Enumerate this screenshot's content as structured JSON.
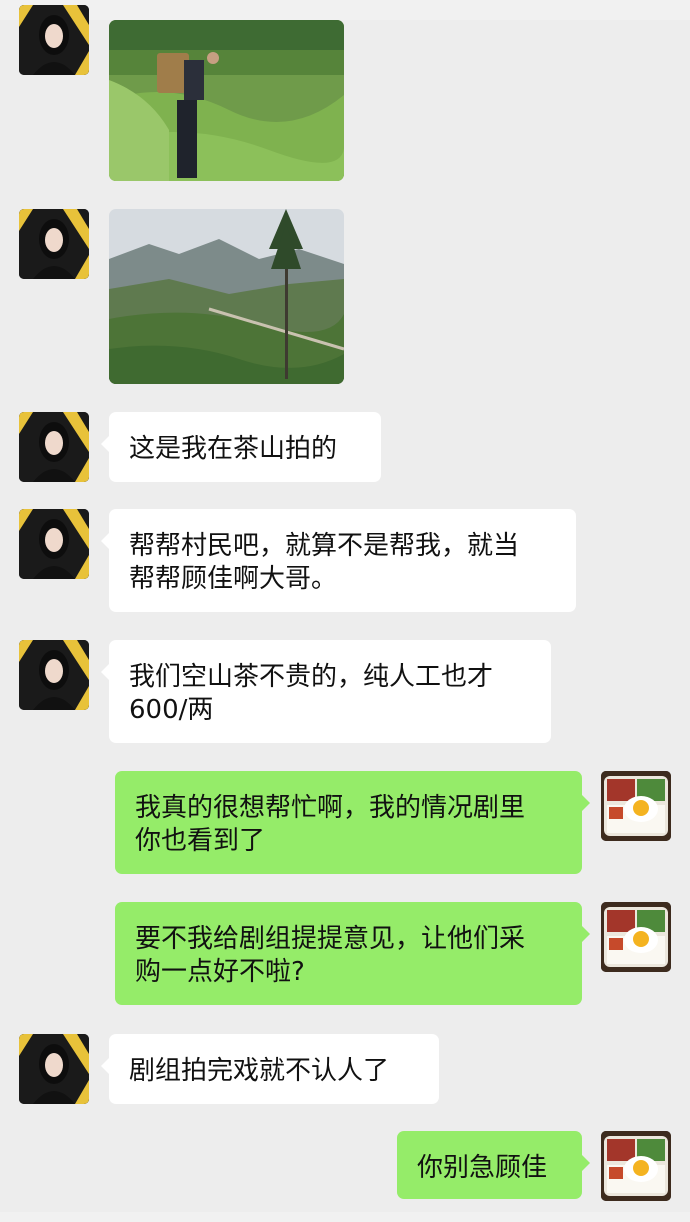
{
  "messages": [
    {
      "side": "left",
      "type": "image",
      "image": "tea-farmer-photo"
    },
    {
      "side": "left",
      "type": "image",
      "image": "tea-mountain-photo"
    },
    {
      "side": "left",
      "type": "text",
      "lines": [
        "这是我在茶山拍的"
      ]
    },
    {
      "side": "left",
      "type": "text",
      "lines": [
        "帮帮村民吧，就算不是帮我，就当",
        "帮帮顾佳啊大哥。"
      ]
    },
    {
      "side": "left",
      "type": "text",
      "lines": [
        "我们空山茶不贵的，纯人工也才",
        "600/两"
      ]
    },
    {
      "side": "right",
      "type": "text",
      "lines": [
        "我真的很想帮忙啊，我的情况剧里",
        "你也看到了"
      ]
    },
    {
      "side": "right",
      "type": "text",
      "lines": [
        "要不我给剧组提提意见，让他们采",
        "购一点好不啦?"
      ]
    },
    {
      "side": "left",
      "type": "text",
      "lines": [
        "剧组拍完戏就不认人了"
      ]
    },
    {
      "side": "right",
      "type": "text",
      "lines": [
        "你别急顾佳"
      ]
    }
  ],
  "avatars": {
    "contact": "woman-portrait-avatar",
    "self": "fried-egg-rice-avatar"
  },
  "colors": {
    "background": "#ededed",
    "incoming_bubble": "#ffffff",
    "outgoing_bubble": "#95ec69",
    "text": "#111111"
  }
}
